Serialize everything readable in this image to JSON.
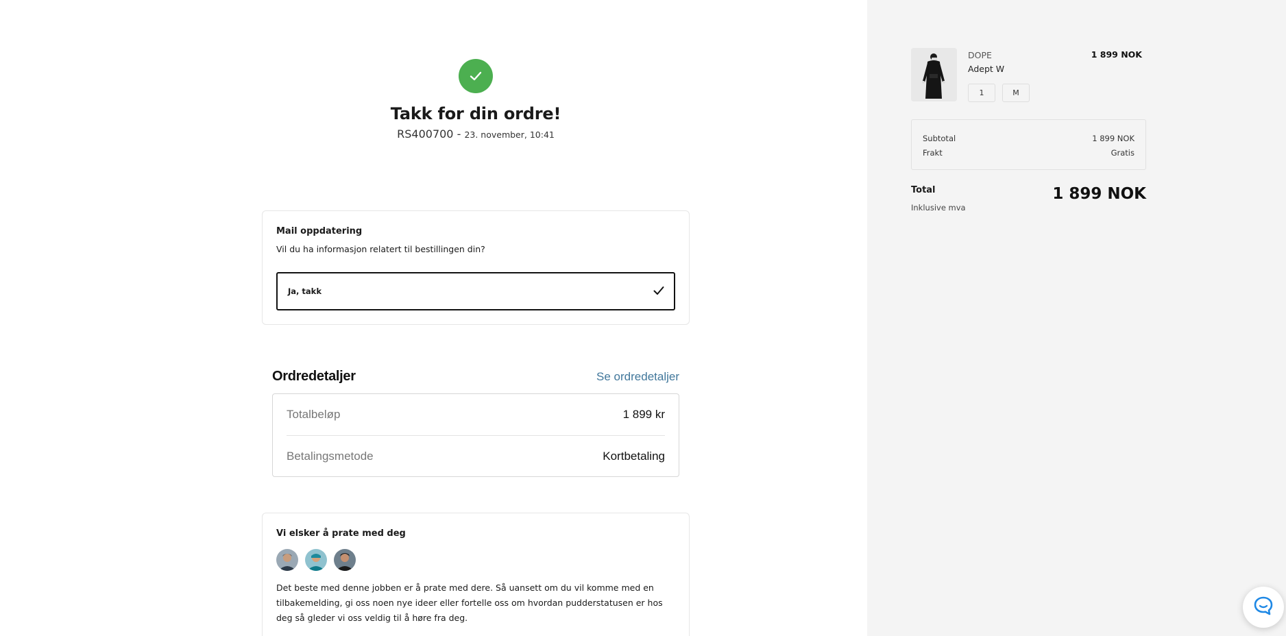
{
  "confirmation": {
    "title": "Takk for din ordre!",
    "order_number": "RS400700 -",
    "order_date": "23. november, 10:41"
  },
  "mail_update": {
    "title": "Mail oppdatering",
    "question": "Vil du ha informasjon relatert til bestillingen din?",
    "option_label": "Ja, takk",
    "option_selected": true
  },
  "order_details": {
    "title": "Ordredetaljer",
    "link_label": "Se ordredetaljer",
    "rows": [
      {
        "label": "Totalbeløp",
        "value": "1 899 kr"
      },
      {
        "label": "Betalingsmetode",
        "value": "Kortbetaling"
      }
    ]
  },
  "chat_card": {
    "title": "Vi elsker å prate med deg",
    "text": "Det beste med denne jobben er å prate med dere. Så uansett om du vil komme med en tilbakemelding, gi oss noen nye ideer eller fortelle oss om hvordan pudderstatusen er hos deg så gleder vi oss veldig til å høre fra deg."
  },
  "summary": {
    "item": {
      "brand": "DOPE",
      "name": "Adept W",
      "price": "1 899 NOK",
      "quantity": "1",
      "size": "M"
    },
    "subtotal_label": "Subtotal",
    "subtotal_value": "1 899 NOK",
    "shipping_label": "Frakt",
    "shipping_value": "Gratis",
    "total_label": "Total",
    "total_value": "1 899 NOK",
    "vat_note": "Inklusive mva"
  },
  "colors": {
    "success": "#4caf50",
    "link": "#41779b",
    "summary_bg": "#f4f4f4",
    "chat_icon": "#1e88e5"
  }
}
